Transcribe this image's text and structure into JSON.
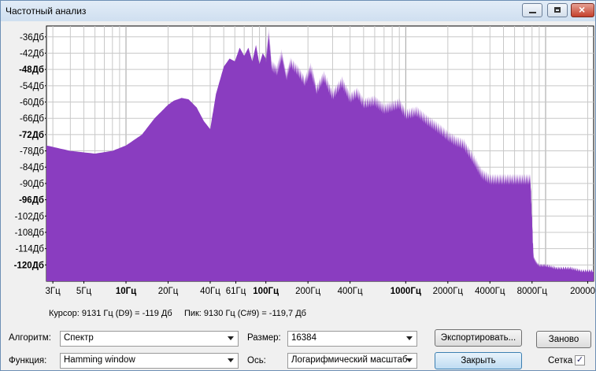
{
  "window": {
    "title": "Частотный анализ"
  },
  "chart_data": {
    "type": "area",
    "x_scale": "log",
    "xlim": [
      2.7,
      22050
    ],
    "ylim": [
      -126,
      -32
    ],
    "y_ticks": [
      {
        "value": -36,
        "label": "-36Дб",
        "bold": false
      },
      {
        "value": -42,
        "label": "-42Дб",
        "bold": false
      },
      {
        "value": -48,
        "label": "-48Дб",
        "bold": true
      },
      {
        "value": -54,
        "label": "-54Дб",
        "bold": false
      },
      {
        "value": -60,
        "label": "-60Дб",
        "bold": false
      },
      {
        "value": -66,
        "label": "-66Дб",
        "bold": false
      },
      {
        "value": -72,
        "label": "-72Дб",
        "bold": true
      },
      {
        "value": -78,
        "label": "-78Дб",
        "bold": false
      },
      {
        "value": -84,
        "label": "-84Дб",
        "bold": false
      },
      {
        "value": -90,
        "label": "-90Дб",
        "bold": false
      },
      {
        "value": -96,
        "label": "-96Дб",
        "bold": true
      },
      {
        "value": -102,
        "label": "-102Дб",
        "bold": false
      },
      {
        "value": -108,
        "label": "-108Дб",
        "bold": false
      },
      {
        "value": -114,
        "label": "-114Дб",
        "bold": false
      },
      {
        "value": -120,
        "label": "-120Дб",
        "bold": true
      }
    ],
    "x_ticks": [
      {
        "value": 3,
        "label": "3Гц",
        "bold": false
      },
      {
        "value": 5,
        "label": "5Гц",
        "bold": false
      },
      {
        "value": 10,
        "label": "10Гц",
        "bold": true
      },
      {
        "value": 20,
        "label": "20Гц",
        "bold": false
      },
      {
        "value": 40,
        "label": "40Гц",
        "bold": false
      },
      {
        "value": 61,
        "label": "61Гц",
        "bold": false
      },
      {
        "value": 100,
        "label": "100Гц",
        "bold": true
      },
      {
        "value": 200,
        "label": "200Гц",
        "bold": false
      },
      {
        "value": 400,
        "label": "400Гц",
        "bold": false
      },
      {
        "value": 1000,
        "label": "1000Гц",
        "bold": true
      },
      {
        "value": 2000,
        "label": "2000Гц",
        "bold": false
      },
      {
        "value": 4000,
        "label": "4000Гц",
        "bold": false
      },
      {
        "value": 8000,
        "label": "8000Гц",
        "bold": false
      },
      {
        "value": 20000,
        "label": "20000Гц",
        "bold": false
      }
    ],
    "grid": true,
    "fill_color": "#8a3dc0",
    "series": [
      {
        "x": [
          2.7,
          4,
          6,
          8,
          10,
          13,
          16,
          20,
          22,
          25,
          28,
          32,
          36,
          40,
          44,
          50,
          55,
          60,
          65,
          70,
          75,
          80,
          85,
          90,
          95,
          100,
          105,
          110,
          120,
          130,
          140,
          150,
          170,
          190,
          210,
          230,
          260,
          300,
          350,
          400,
          450,
          500,
          600,
          700,
          800,
          900,
          1000,
          1200,
          1400,
          1600,
          1800,
          2000,
          2300,
          2600,
          3000,
          3500,
          4000,
          4500,
          5000,
          6000,
          7000,
          7800,
          8200,
          8600,
          9000,
          10000,
          12000,
          15000,
          18000,
          22050
        ],
        "y": [
          -76,
          -78,
          -79,
          -78,
          -76,
          -72,
          -66,
          -61,
          -59.5,
          -58.5,
          -59,
          -62,
          -67,
          -70,
          -57,
          -47,
          -44,
          -45,
          -40,
          -43,
          -40,
          -45,
          -39,
          -46,
          -42,
          -44,
          -34,
          -46,
          -48,
          -42,
          -50,
          -45,
          -48,
          -52,
          -47,
          -55,
          -50,
          -57,
          -52,
          -58,
          -56,
          -60,
          -59,
          -62,
          -61,
          -60,
          -64,
          -63,
          -66,
          -68,
          -70,
          -72,
          -74,
          -75,
          -80,
          -86,
          -88,
          -88,
          -88,
          -88,
          -88,
          -88,
          -117,
          -119,
          -120,
          -120,
          -121,
          -121,
          -122,
          -122
        ]
      }
    ]
  },
  "status": {
    "cursor_text": "Курсор: 9131 Гц (D9) = -119 Дб",
    "peak_text": "Пик: 9130 Гц (C#9) = -119,7 Дб"
  },
  "controls": {
    "algorithm_label": "Алгоритм:",
    "algorithm_value": "Спектр",
    "function_label": "Функция:",
    "function_value": "Hamming window",
    "size_label": "Размер:",
    "size_value": "16384",
    "axis_label": "Ось:",
    "axis_value": "Логарифмический масштаб",
    "export_button": "Экспортировать...",
    "replot_button": "Заново",
    "close_button": "Закрыть",
    "grid_label": "Сетка",
    "grid_checked": true
  }
}
